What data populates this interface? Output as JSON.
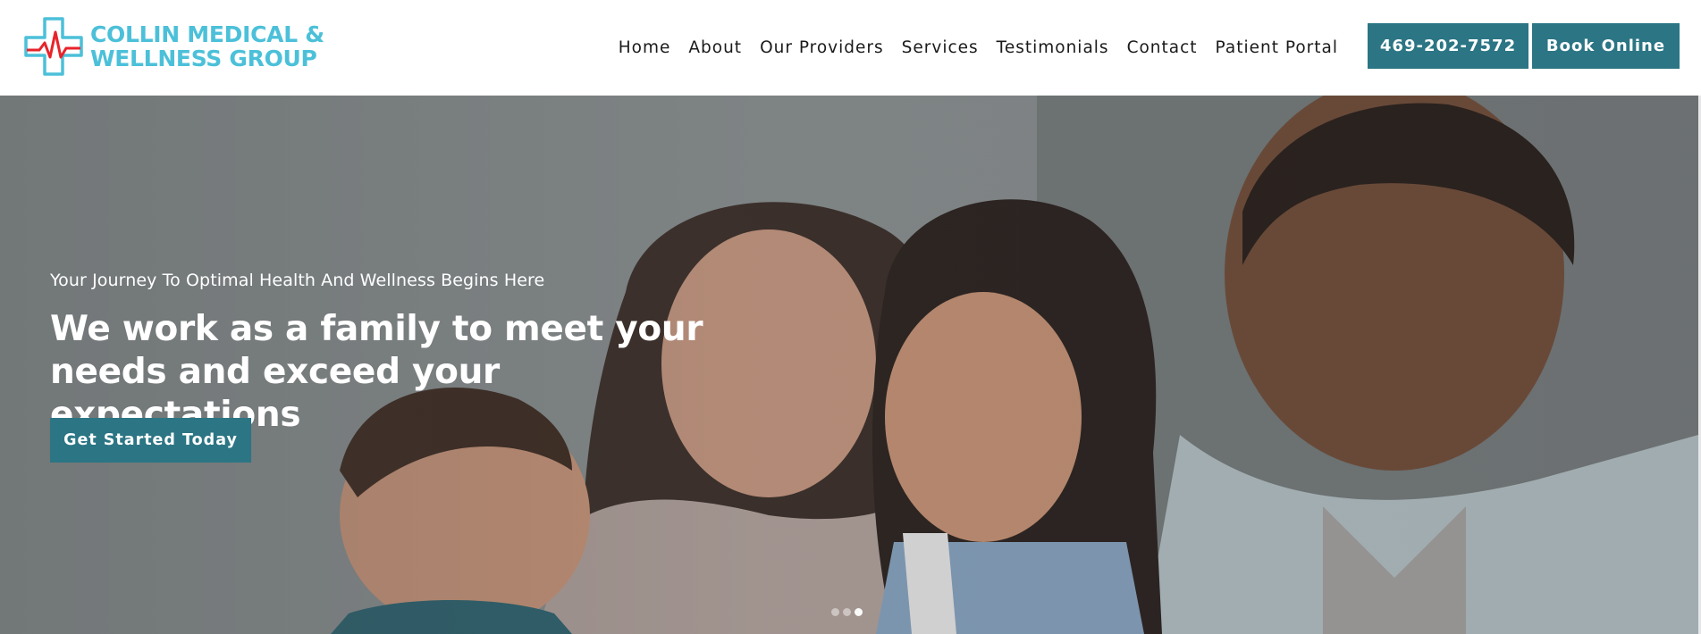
{
  "brand": {
    "name_line1": "COLLIN MEDICAL &",
    "name_line2": "WELLNESS GROUP",
    "logo_icon": "medical-cross-heartbeat-icon",
    "color": "#4cc0d9"
  },
  "nav": {
    "items": [
      {
        "label": "Home"
      },
      {
        "label": "About"
      },
      {
        "label": "Our Providers"
      },
      {
        "label": "Services"
      },
      {
        "label": "Testimonials"
      },
      {
        "label": "Contact"
      },
      {
        "label": "Patient Portal"
      }
    ]
  },
  "header_buttons": {
    "phone_label": "469-202-7572",
    "book_label": "Book Online",
    "accent": "#2b7584"
  },
  "hero": {
    "eyebrow": "Your Journey To Optimal Health And Wellness Begins Here",
    "title_line1": "We work as a family to meet your",
    "title_line2": "needs and exceed your expectations",
    "cta_label": "Get Started Today",
    "image_subject": "family-photo",
    "slides": {
      "count": 3,
      "active": 3
    }
  }
}
